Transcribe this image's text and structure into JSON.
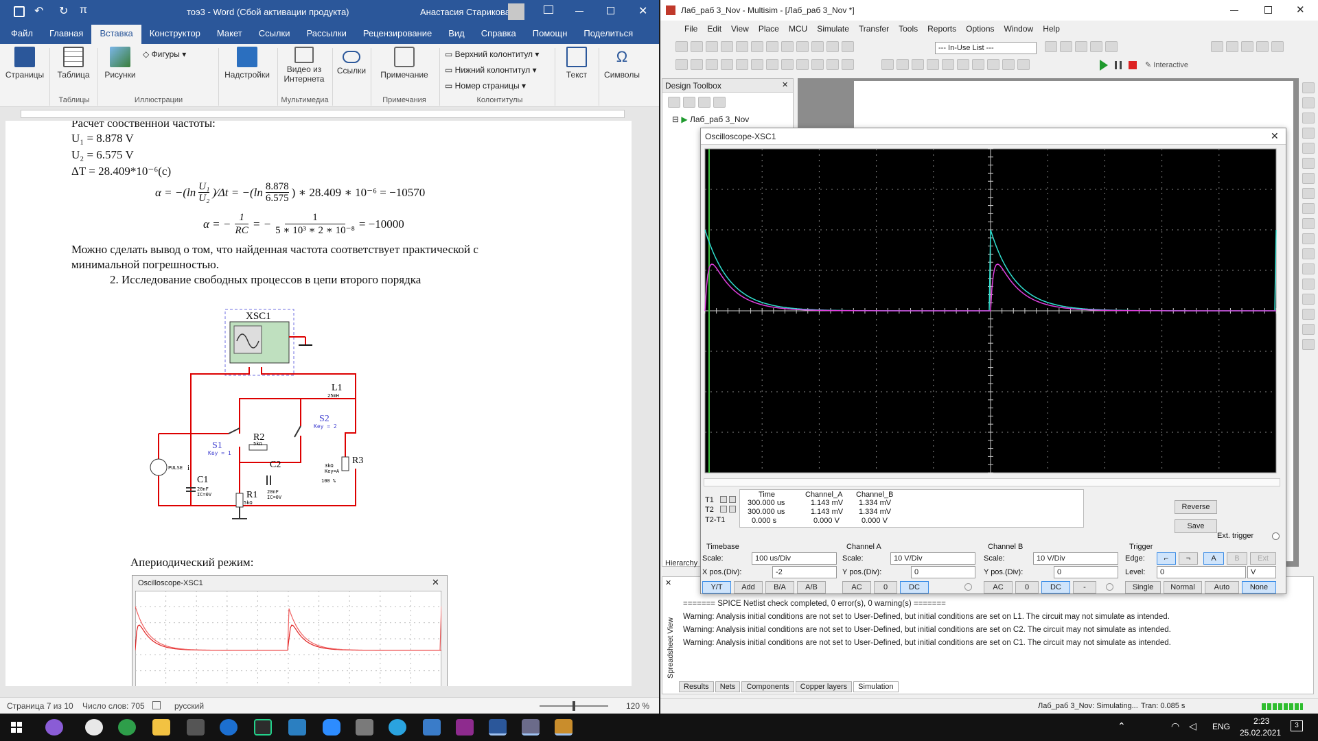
{
  "word": {
    "title": "тоэ3 - Word (Сбой активации продукта)",
    "user": "Анастасия Старикова",
    "tabs": [
      "Файл",
      "Главная",
      "Вставка",
      "Конструктор",
      "Макет",
      "Ссылки",
      "Рассылки",
      "Рецензирование",
      "Вид",
      "Справка",
      "Помощн",
      "Поделиться"
    ],
    "active_tab": "Вставка",
    "ribbon": {
      "pages": "Страницы",
      "table": "Таблица",
      "pictures": "Рисунки",
      "shapes": "Фигуры",
      "addins": "Надстройки",
      "video": "Видео из Интернета",
      "links": "Ссылки",
      "comment": "Примечание",
      "header": "Верхний колонтитул",
      "footer": "Нижний колонтитул",
      "pagenum": "Номер страницы",
      "text": "Текст",
      "symbols": "Символы",
      "groups": [
        "Таблицы",
        "Иллюстрации",
        "Мультимедиа",
        "Примечания",
        "Колонтитулы"
      ]
    },
    "document": {
      "line0": "Расчет собственной частоты:",
      "u1": "U₁ = 8.878 V",
      "u2": "U₂ = 6.575 V",
      "dt": "ΔT = 28.409*10⁻⁶(c)",
      "eq1_left": "α = −(ln",
      "eq1_u1": "U₁",
      "eq1_u2": "U₂",
      "eq1_mid": ")∕Δt = −(ln",
      "eq1_n": "8.878",
      "eq1_d": "6.575",
      "eq1_right": ") ∗ 28.409 ∗ 10⁻⁶ =  −10570",
      "eq2_left": "α = −",
      "eq2_n1": "1",
      "eq2_d1": "RC",
      "eq2_mid": "= −",
      "eq2_n2": "1",
      "eq2_d2": "5 ∗ 10³ ∗ 2 ∗ 10⁻⁸",
      "eq2_right": "= −10000",
      "conclusion1": "Можно сделать вывод о том, что найденная частота соответствует практической с",
      "conclusion2": "минимальной погрешностью.",
      "section": "2.   Исследование свободных процессов в цепи второго порядка",
      "aperiodic": "Апериодический режим:"
    },
    "schematic": {
      "xsc": "XSC1",
      "l1": "L1",
      "l1_val": "25mH",
      "r2": "R2",
      "r2_val": "5kΩ",
      "s2": "S2",
      "s2_key": "Key = 2",
      "s1": "S1",
      "s1_key": "Key = 1",
      "c2": "C2",
      "c2_val": "20nF",
      "c2_ic": "IC=0V",
      "r3": "R3",
      "r3_val": "3kΩ",
      "r3_key": "Key=A",
      "r3_pct": "100 %",
      "c1": "C1",
      "c1_val": "20nF",
      "c1_ic": "IC=0V",
      "r1": "R1",
      "r1_val": "5kΩ",
      "pulse": "PULSE",
      "pulse_i": "i"
    },
    "embedded_osc_title": "Oscilloscope-XSC1",
    "status": {
      "page": "Страница 7 из 10",
      "words": "Число слов: 705",
      "lang": "русский",
      "zoom": "120 %"
    }
  },
  "multisim": {
    "title": "Лаб_раб 3_Nov - Multisim - [Лаб_раб 3_Nov *]",
    "menu": [
      "File",
      "Edit",
      "View",
      "Place",
      "MCU",
      "Simulate",
      "Transfer",
      "Tools",
      "Reports",
      "Options",
      "Window",
      "Help"
    ],
    "in_use_list": "--- In-Use List ---",
    "interactive": "Interactive",
    "design_toolbox": "Design Toolbox",
    "tree_root": "Лаб_раб 3_Nov",
    "hierarchy": "Hierarchy",
    "spreadsheet": "Spreadsheet View",
    "messages": [
      "======= SPICE Netlist check completed, 0 error(s), 0 warning(s) =======",
      "Warning: Analysis initial conditions are not set to User-Defined, but initial conditions are set on L1. The circuit may not simulate as intended.",
      "Warning: Analysis initial conditions are not set to User-Defined, but initial conditions are set on C2. The circuit may not simulate as intended.",
      "Warning: Analysis initial conditions are not set to User-Defined, but initial conditions are set on C1. The circuit may not simulate as intended."
    ],
    "bottom_tabs": [
      "Results",
      "Nets",
      "Components",
      "Copper layers",
      "Simulation"
    ],
    "status_sim": "Лаб_раб 3_Nov: Simulating...",
    "status_tran": "Tran: 0.085 s"
  },
  "osc": {
    "title": "Oscilloscope-XSC1",
    "headers": {
      "time": "Time",
      "cha": "Channel_A",
      "chb": "Channel_B"
    },
    "t1": {
      "label": "T1",
      "time": "300.000 us",
      "a": "1.143 mV",
      "b": "1.334 mV"
    },
    "t2": {
      "label": "T2",
      "time": "300.000 us",
      "a": "1.143 mV",
      "b": "1.334 mV"
    },
    "t21": {
      "label": "T2-T1",
      "time": "0.000 s",
      "a": "0.000 V",
      "b": "0.000 V"
    },
    "reverse": "Reverse",
    "save": "Save",
    "ext_trigger": "Ext. trigger",
    "timebase": {
      "title": "Timebase",
      "scale_label": "Scale:",
      "scale": "100 us/Div",
      "xpos_label": "X pos.(Div):",
      "xpos": "-2",
      "modes": [
        "Y/T",
        "Add",
        "B/A",
        "A/B"
      ]
    },
    "cha": {
      "title": "Channel A",
      "scale_label": "Scale:",
      "scale": "10  V/Div",
      "ypos_label": "Y pos.(Div):",
      "ypos": "0",
      "modes": [
        "AC",
        "0",
        "DC"
      ]
    },
    "chb": {
      "title": "Channel B",
      "scale_label": "Scale:",
      "scale": "10  V/Div",
      "ypos_label": "Y pos.(Div):",
      "ypos": "0",
      "modes": [
        "AC",
        "0",
        "DC",
        "-"
      ]
    },
    "trigger": {
      "title": "Trigger",
      "edge_label": "Edge:",
      "sources": [
        "A",
        "B",
        "Ext"
      ],
      "level_label": "Level:",
      "level": "0",
      "unit": "V",
      "modes": [
        "Single",
        "Normal",
        "Auto",
        "None"
      ]
    },
    "colors": {
      "cha": "#e040e0",
      "chb": "#30e0d0",
      "cursor": "#40c040"
    }
  },
  "taskbar": {
    "lang": "ENG",
    "time": "2:23",
    "date": "25.02.2021",
    "notif": "3"
  }
}
